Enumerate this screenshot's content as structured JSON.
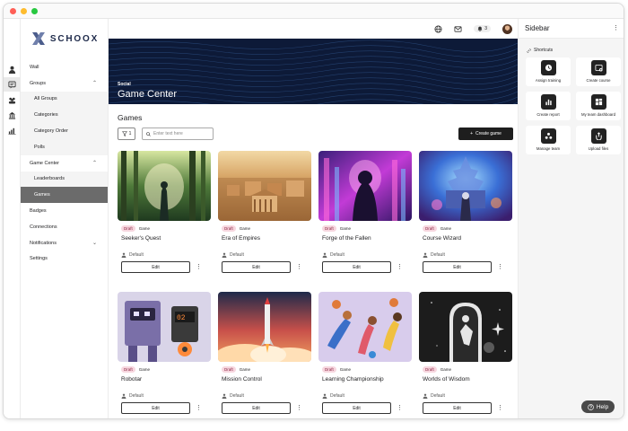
{
  "window": {
    "dots": [
      "#ff5f57",
      "#febc2e",
      "#28c840"
    ]
  },
  "brand": {
    "logo_text": "SCHOOX",
    "accent": "#4c5d8c"
  },
  "iconbar": [
    "user-icon",
    "chat-icon",
    "people-icon",
    "building-icon",
    "chart-icon"
  ],
  "nav": [
    {
      "label": "Wall",
      "type": "top"
    },
    {
      "label": "Groups",
      "type": "top",
      "chevron": "up"
    },
    {
      "label": "All Groups",
      "type": "sub"
    },
    {
      "label": "Categories",
      "type": "sub"
    },
    {
      "label": "Category Order",
      "type": "sub"
    },
    {
      "label": "Polls",
      "type": "sub"
    },
    {
      "label": "Game Center",
      "type": "top",
      "chevron": "up"
    },
    {
      "label": "Leaderboards",
      "type": "sub"
    },
    {
      "label": "Games",
      "type": "sub",
      "active": true
    },
    {
      "label": "Badges",
      "type": "top"
    },
    {
      "label": "Connections",
      "type": "top"
    },
    {
      "label": "Notifications",
      "type": "top",
      "chevron": "down"
    },
    {
      "label": "Settings",
      "type": "top"
    }
  ],
  "topbar": {
    "notification_count": "3"
  },
  "banner": {
    "kicker": "Social",
    "title": "Game Center"
  },
  "games": {
    "heading": "Games",
    "filter_count": "1",
    "search_placeholder": "Enter text here",
    "create_label": "Create game",
    "edit_label": "Edit",
    "items": [
      {
        "title": "Seeker's Quest",
        "status": "Draft",
        "type": "Game",
        "access": "Default"
      },
      {
        "title": "Era of Empires",
        "status": "Draft",
        "type": "Game",
        "access": "Default"
      },
      {
        "title": "Forge of the Fallen",
        "status": "Draft",
        "type": "Game",
        "access": "Default"
      },
      {
        "title": "Course Wizard",
        "status": "Draft",
        "type": "Game",
        "access": "Default"
      },
      {
        "title": "Robotar",
        "status": "Draft",
        "type": "Game",
        "access": "Default"
      },
      {
        "title": "Mission Control",
        "status": "Draft",
        "type": "Game",
        "access": "Default"
      },
      {
        "title": "Learning Championship",
        "status": "Draft",
        "type": "Game",
        "access": "Default"
      },
      {
        "title": "Worlds of Wisdom",
        "status": "Draft",
        "type": "Game",
        "access": "Default"
      }
    ]
  },
  "sidebar": {
    "title": "Sidebar",
    "shortcuts_label": "Shortcuts",
    "shortcuts": [
      {
        "label": "Assign training",
        "icon": "clock-icon"
      },
      {
        "label": "Create course",
        "icon": "create-course-icon"
      },
      {
        "label": "Create report",
        "icon": "bar-chart-icon"
      },
      {
        "label": "My team dashboard",
        "icon": "dashboard-icon"
      },
      {
        "label": "Manage team",
        "icon": "team-icon"
      },
      {
        "label": "Upload files",
        "icon": "upload-icon"
      }
    ]
  },
  "help": {
    "label": "Help"
  }
}
